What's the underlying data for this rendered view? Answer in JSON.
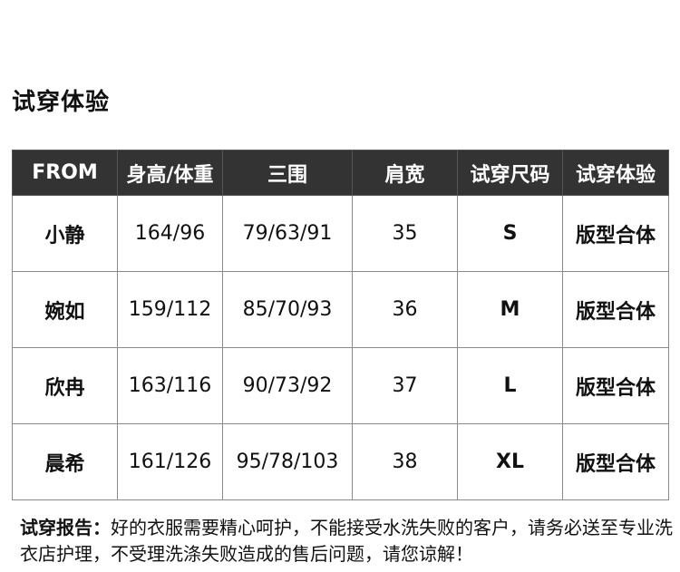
{
  "title": "试穿体验",
  "table": {
    "headers": [
      "FROM",
      "身高/体重",
      "三围",
      "肩宽",
      "试穿尺码",
      "试穿体验"
    ],
    "rows": [
      {
        "name": "小静",
        "height_weight": "164/96",
        "measurements": "79/63/91",
        "shoulder": "35",
        "size": "S",
        "fit": "版型合体"
      },
      {
        "name": "婉如",
        "height_weight": "159/112",
        "measurements": "85/70/93",
        "shoulder": "36",
        "size": "M",
        "fit": "版型合体"
      },
      {
        "name": "欣冉",
        "height_weight": "163/116",
        "measurements": "90/73/92",
        "shoulder": "37",
        "size": "L",
        "fit": "版型合体"
      },
      {
        "name": "晨希",
        "height_weight": "161/126",
        "measurements": "95/78/103",
        "shoulder": "38",
        "size": "XL",
        "fit": "版型合体"
      }
    ]
  },
  "note": {
    "label": "试穿报告：",
    "text": "好的衣服需要精心呵护，不能接受水洗失败的客户，请务必送至专业洗衣店护理，不受理洗涤失败造成的售后问题，请您谅解！"
  }
}
